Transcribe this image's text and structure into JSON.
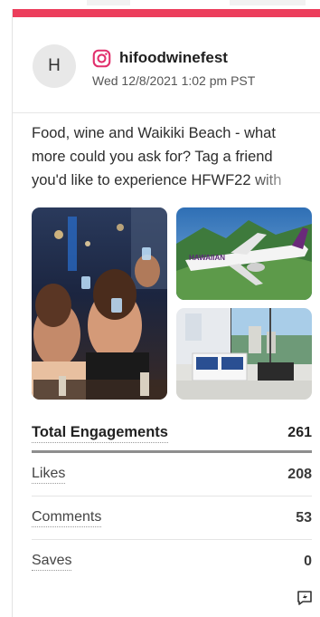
{
  "post": {
    "avatar_initial": "H",
    "platform_icon": "instagram-icon",
    "account": "hifoodwinefest",
    "date": "Wed 12/8/2021 1:02 pm PST",
    "text": "Food, wine and Waikiki Beach - what more could you ask for? Tag a friend you'd like to experience HFWF22 with"
  },
  "media": [
    {
      "name": "party-photo",
      "description": ""
    },
    {
      "name": "airplane-photo",
      "caption": "HAWAIIAN"
    },
    {
      "name": "hotel-room-photo",
      "description": ""
    }
  ],
  "stats": {
    "total_label": "Total Engagements",
    "total_value": "261",
    "rows": [
      {
        "label": "Likes",
        "value": "208"
      },
      {
        "label": "Comments",
        "value": "53"
      },
      {
        "label": "Saves",
        "value": "0"
      }
    ]
  },
  "colors": {
    "accent": "#ec3e5c",
    "instagram": "#e1306c"
  }
}
